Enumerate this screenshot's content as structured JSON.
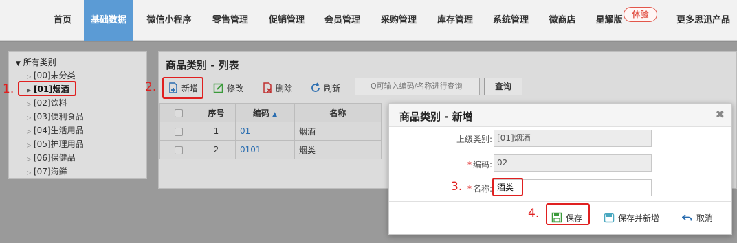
{
  "nav": {
    "items": [
      "首页",
      "基础数据",
      "微信小程序",
      "零售管理",
      "促销管理",
      "会员管理",
      "采购管理",
      "库存管理",
      "系统管理",
      "微商店",
      "星耀版",
      "更多思迅产品"
    ],
    "active_index": 1,
    "badge": "体验"
  },
  "tree": {
    "root": "所有类别",
    "items": [
      "[00]未分类",
      "[01]烟酒",
      "[02]饮料",
      "[03]便利食品",
      "[04]生活用品",
      "[05]护理用品",
      "[06]保健品",
      "[07]海鲜"
    ],
    "selected_index": 1
  },
  "list": {
    "title": "商品类别 - 列表",
    "toolbar": {
      "new": "新增",
      "edit": "修改",
      "delete": "删除",
      "refresh": "刷新"
    },
    "search_placeholder": "Q可输入编码/名称进行查询",
    "query_button": "查询",
    "columns": [
      "序号",
      "编码",
      "名称"
    ],
    "sort_indicator": "▲",
    "rows": [
      {
        "index": "1",
        "code": "01",
        "name": "烟酒"
      },
      {
        "index": "2",
        "code": "0101",
        "name": "烟类"
      }
    ]
  },
  "dialog": {
    "title": "商品类别 - 新增",
    "close": "✖",
    "fields": {
      "parent_label": "上级类别:",
      "parent_value": "[01]烟酒",
      "code_label": "编码:",
      "code_value": "02",
      "name_label": "名称:",
      "name_value": "酒类"
    },
    "buttons": {
      "save": "保存",
      "save_new": "保存并新增",
      "cancel": "取消"
    }
  },
  "steps": [
    "1.",
    "2.",
    "3.",
    "4."
  ],
  "colors": {
    "active_nav": "#5b9bd5",
    "annotation_red": "#e02020",
    "link_blue": "#2a6db0"
  }
}
